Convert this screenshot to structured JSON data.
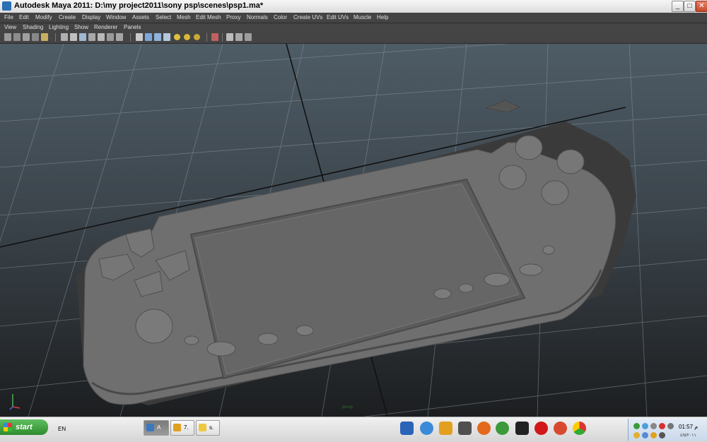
{
  "window": {
    "title": "Autodesk Maya 2011: D:\\my project2011\\sony psp\\scenes\\psp1.ma*"
  },
  "menubar": [
    "File",
    "Edit",
    "Modify",
    "Create",
    "Display",
    "Window",
    "Assets",
    "Select",
    "Mesh",
    "Edit Mesh",
    "Proxy",
    "Normals",
    "Color",
    "Create UVs",
    "Edit UVs",
    "Muscle",
    "Help"
  ],
  "panel_menu": [
    "View",
    "Shading",
    "Lighting",
    "Show",
    "Renderer",
    "Panels"
  ],
  "toolbar_icons": [
    "camera-attributes-icon",
    "bookmark-icon",
    "image-plane-icon",
    "two-d-pan-icon",
    "grease-pencil-icon",
    "grid-toggle-icon",
    "film-gate-icon",
    "resolution-gate-icon",
    "gate-mask-icon",
    "field-chart-icon",
    "safe-action-icon",
    "safe-title-icon",
    "wireframe-icon",
    "smooth-shade-icon",
    "shade-all-icon",
    "wireframe-on-shaded-icon",
    "use-default-light-icon",
    "shadows-icon",
    "textured-icon",
    "xray-icon",
    "isolate-select-icon",
    "high-quality-icon",
    "xray-joints-icon"
  ],
  "viewport": {
    "camera": "persp",
    "background_top": "#4e5c66",
    "background_bottom": "#1c1e20",
    "model_color": "#6d6d6d"
  },
  "taskbar": {
    "start_label": "start",
    "language": "EN",
    "tasks": [
      {
        "label": "A",
        "active": true
      },
      {
        "label": "7.",
        "active": false
      },
      {
        "label": "s.",
        "active": false
      }
    ],
    "quick_launch": [
      "desktop-icon",
      "internet-explorer-icon",
      "flashget-icon",
      "cursor-tool-icon",
      "firefox-icon",
      "utorrent-icon",
      "media-player-icon",
      "opera-icon",
      "game-icon",
      "chrome-icon"
    ],
    "tray_time": "01:57 م",
    "tray_date": "٤/٥/٢٠١١"
  }
}
